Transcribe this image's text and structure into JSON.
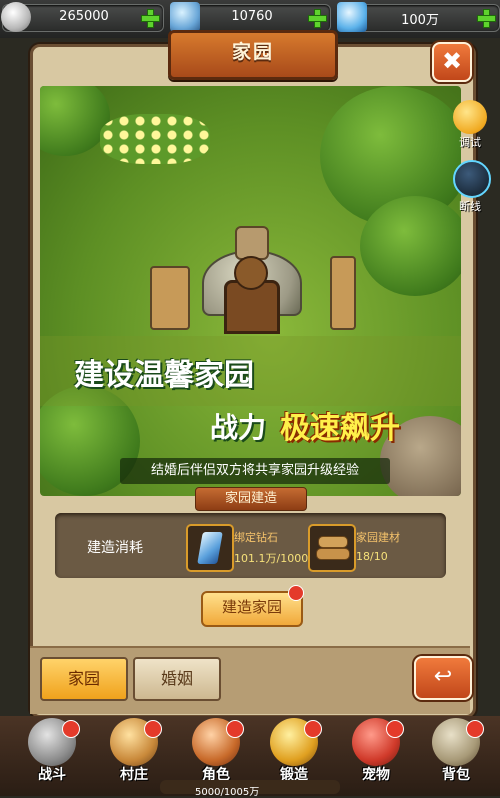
{
  "currency": [
    {
      "icon": "silver-coin-icon",
      "value": "265000"
    },
    {
      "icon": "bound-diamond-icon",
      "value": "10760"
    },
    {
      "icon": "diamond-icon",
      "value": "100万"
    }
  ],
  "panel": {
    "title": "家园",
    "close_icon": "close-icon"
  },
  "side": {
    "debug_label": "调试",
    "disconnect_label": "断线"
  },
  "banner": {
    "headline_1": "建设温馨家园",
    "headline_2": "战力",
    "headline_3": "极速飙升",
    "subline": "结婚后伴侣双方将共享家园升级经验"
  },
  "build": {
    "section_title": "家园建造",
    "cost_label": "建造消耗",
    "items": [
      {
        "name": "绑定钻石",
        "value": "101.1万/1000"
      },
      {
        "name": "家园建材",
        "value": "18/10"
      }
    ],
    "button_label": "建造家园"
  },
  "tabs": [
    {
      "label": "家园"
    },
    {
      "label": "婚姻"
    }
  ],
  "nav": [
    {
      "label": "战斗"
    },
    {
      "label": "村庄"
    },
    {
      "label": "角色"
    },
    {
      "label": "锻造"
    },
    {
      "label": "宠物"
    },
    {
      "label": "背包"
    }
  ],
  "energy": "5000/1005万",
  "colors": {
    "accent": "#e06a2a",
    "gold": "#f1a93a",
    "badge": "#e43a2a"
  }
}
